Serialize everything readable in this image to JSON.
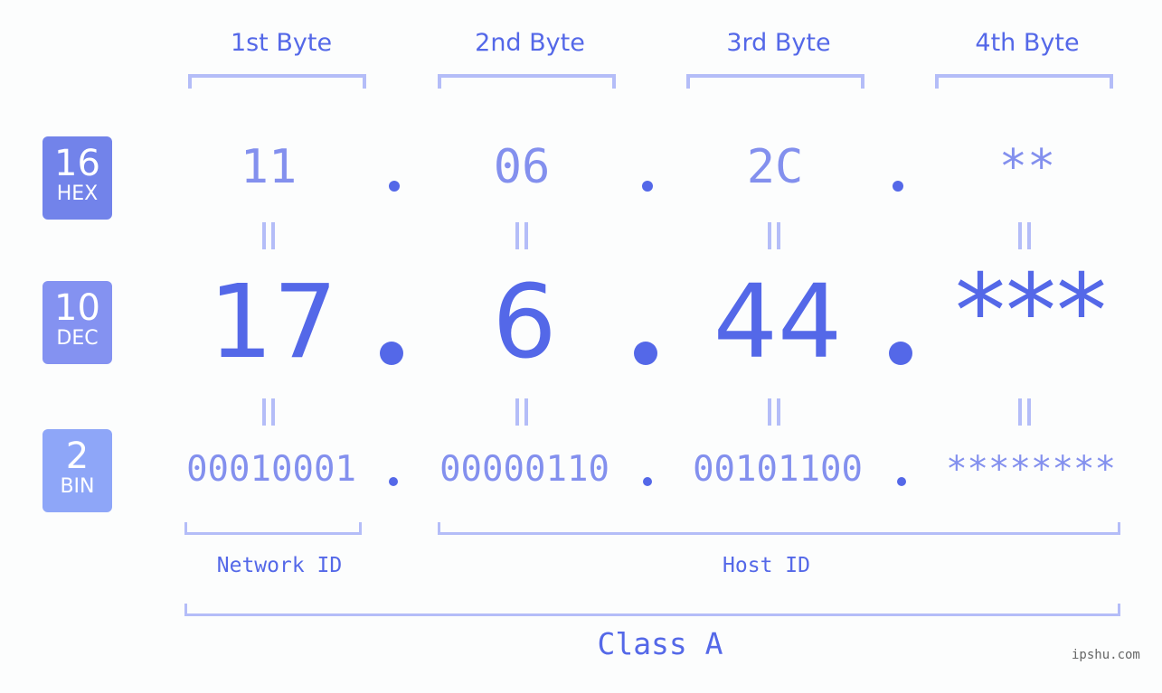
{
  "bytes": [
    {
      "header": "1st Byte",
      "hex": "11",
      "dec": "17",
      "bin": "00010001"
    },
    {
      "header": "2nd Byte",
      "hex": "06",
      "dec": "6",
      "bin": "00000110"
    },
    {
      "header": "3rd Byte",
      "hex": "2C",
      "dec": "44",
      "bin": "00101100"
    },
    {
      "header": "4th Byte",
      "hex": "**",
      "dec": "***",
      "bin": "********"
    }
  ],
  "badges": {
    "hex": {
      "number": "16",
      "label": "HEX",
      "color": "#7283ea"
    },
    "dec": {
      "number": "10",
      "label": "DEC",
      "color": "#8492f1"
    },
    "bin": {
      "number": "2",
      "label": "BIN",
      "color": "#8ea6f8"
    }
  },
  "labels": {
    "network_id": "Network ID",
    "host_id": "Host ID",
    "class": "Class A"
  },
  "watermark": "ipshu.com",
  "colors": {
    "accent": "#5468e8",
    "light_accent": "#8390ee",
    "bracket": "#b4bdf8"
  }
}
